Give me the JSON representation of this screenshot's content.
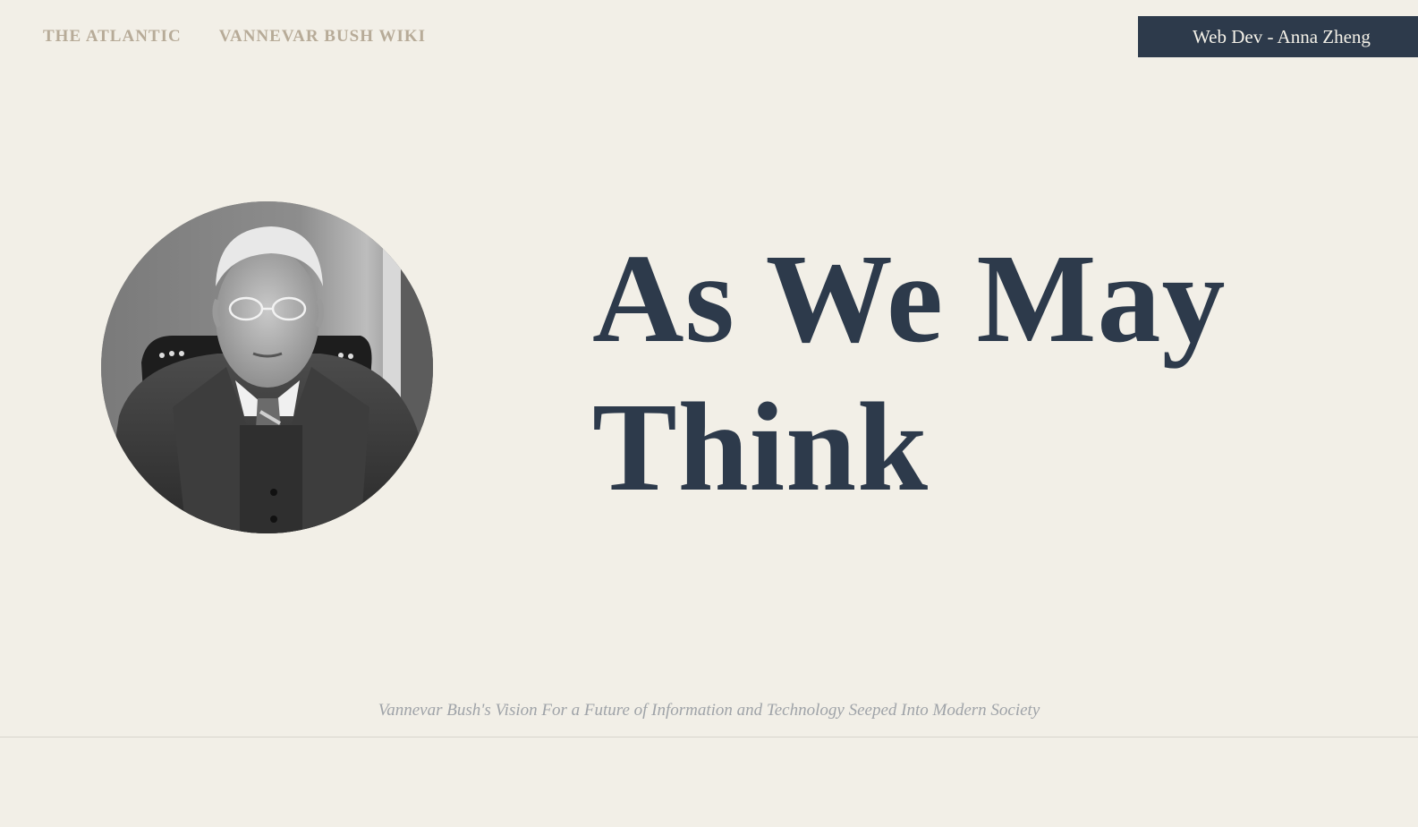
{
  "nav": {
    "links": [
      {
        "label": "THE ATLANTIC"
      },
      {
        "label": "VANNEVAR BUSH WIKI"
      }
    ],
    "author_label": "Web Dev - Anna Zheng"
  },
  "hero": {
    "title_line1": "As We May",
    "title_line2": "Think",
    "subtitle": "Vannevar Bush's Vision For a Future of Information and Technology Seeped Into Modern Society"
  },
  "colors": {
    "background": "#f2efe7",
    "title": "#2d3a4b",
    "nav_link": "#b7ab98",
    "author_tab_bg": "#2d3a4b",
    "subtitle": "#9fa3a8"
  }
}
